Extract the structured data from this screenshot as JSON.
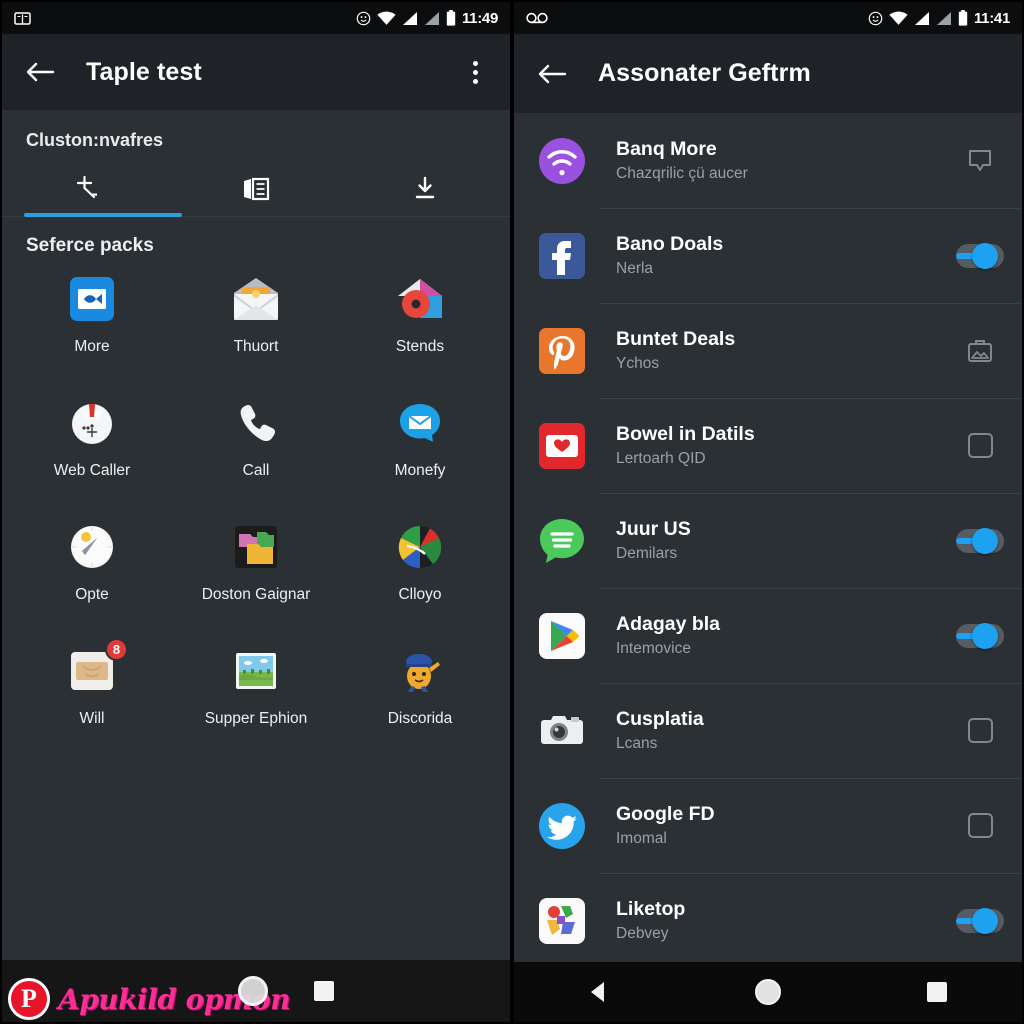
{
  "left": {
    "statusbar": {
      "time": "11:49",
      "left_icons": [
        "book-notification-icon"
      ],
      "right_icons": [
        "face-icon",
        "wifi-icon",
        "signal-icon",
        "signal-2-icon",
        "battery-icon"
      ]
    },
    "appbar": {
      "back_icon": "back-arrow-icon",
      "title": "Taple test",
      "overflow_icon": "overflow-menu-icon"
    },
    "section_label": "Cluston:nvafres",
    "tabs": [
      {
        "icon": "scatter-plot-icon",
        "selected": true
      },
      {
        "icon": "card-list-icon",
        "selected": false
      },
      {
        "icon": "download-icon",
        "selected": false
      }
    ],
    "pack_header": "Seferce packs",
    "apps": [
      {
        "label": "More",
        "icon": "blue-fish-icon",
        "badge": null
      },
      {
        "label": "Thuort",
        "icon": "open-envelope-icon",
        "badge": null
      },
      {
        "label": "Stends",
        "icon": "red-disc-house-icon",
        "badge": null
      },
      {
        "label": "Web Caller",
        "icon": "white-crown-face-icon",
        "badge": null
      },
      {
        "label": "Call",
        "icon": "phone-handset-icon",
        "badge": null
      },
      {
        "label": "Monefy",
        "icon": "blue-mail-chat-icon",
        "badge": null
      },
      {
        "label": "Opte",
        "icon": "compass-icon",
        "badge": null
      },
      {
        "label": "Doston Gaignar",
        "icon": "colored-folders-icon",
        "badge": null
      },
      {
        "label": "Clloyo",
        "icon": "pie-chart-icon",
        "badge": null
      },
      {
        "label": "Will",
        "icon": "wallet-card-icon",
        "badge": "8"
      },
      {
        "label": "Supper Ephion",
        "icon": "landscape-photo-icon",
        "badge": null
      },
      {
        "label": "Discorida",
        "icon": "mascot-icon",
        "badge": null
      }
    ],
    "navbar": {
      "promo_badge": "P",
      "promo_text": "Apukild opmon",
      "home_icon": "home-circle-icon",
      "recents_icon": "recents-square-icon"
    }
  },
  "right": {
    "statusbar": {
      "time": "11:41",
      "left_icons": [
        "voicemail-icon"
      ],
      "right_icons": [
        "face-icon",
        "wifi-icon",
        "signal-icon",
        "signal-2-icon",
        "battery-icon"
      ]
    },
    "appbar": {
      "back_icon": "back-arrow-icon",
      "title": "Assonater Geftrm"
    },
    "items": [
      {
        "title": "Banq More",
        "subtitle": "Chazqrilic çü aucer",
        "icon": "wifi-purple-icon",
        "control": "bubble",
        "on": false
      },
      {
        "title": "Bano Doals",
        "subtitle": "Nerla",
        "icon": "facebook-icon",
        "control": "switch",
        "on": true
      },
      {
        "title": "Buntet Deals",
        "subtitle": "Ychos",
        "icon": "pinterest-icon",
        "control": "image",
        "on": false
      },
      {
        "title": "Bowel in Datils",
        "subtitle": "Lertoarh QID",
        "icon": "red-heart-mail-icon",
        "control": "checkbox",
        "on": false
      },
      {
        "title": "Juur US",
        "subtitle": "Demilars",
        "icon": "spotify-green-icon",
        "control": "switch",
        "on": true
      },
      {
        "title": "Adagay bla",
        "subtitle": "Intemovice",
        "icon": "play-store-icon",
        "control": "switch",
        "on": true
      },
      {
        "title": "Cusplatia",
        "subtitle": "Lcans",
        "icon": "camera-icon",
        "control": "checkbox",
        "on": false
      },
      {
        "title": "Google FD",
        "subtitle": "Imomal",
        "icon": "twitter-icon",
        "control": "checkbox",
        "on": false
      },
      {
        "title": "Liketop",
        "subtitle": "Debvey",
        "icon": "photos-collage-icon",
        "control": "switch",
        "on": true
      }
    ],
    "navbar": {
      "back_icon": "nav-back-triangle-icon",
      "home_icon": "home-circle-icon",
      "recents_icon": "recents-square-icon"
    }
  },
  "colors": {
    "accent": "#2b9fe0",
    "toggle_on": "#1ea1f0",
    "appbar": "#1f2327",
    "body": "#2b3034",
    "badge": "#e23a3a",
    "promo": "#ff2d95"
  }
}
